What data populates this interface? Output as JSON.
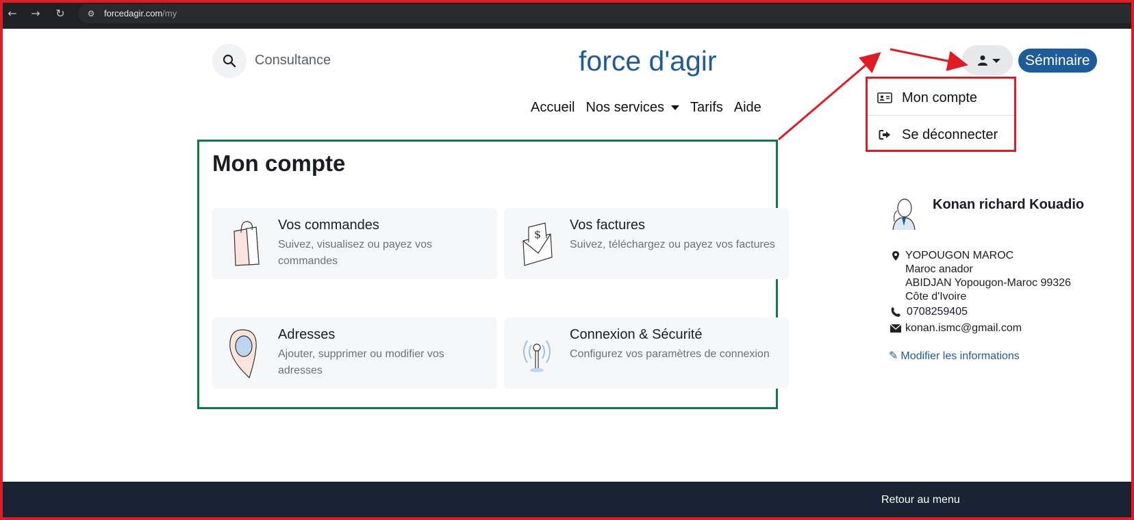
{
  "browser": {
    "url_host": "forcedagir.com",
    "url_path": "/my",
    "back_icon": "arrow-left-icon",
    "forward_icon": "arrow-right-icon",
    "reload_icon": "reload-icon"
  },
  "header": {
    "search_placeholder": "Consultance",
    "brand": "force d'agir",
    "seminaire": "Séminaire"
  },
  "nav": {
    "items": [
      "Accueil",
      "Nos services",
      "Tarifs",
      "Aide"
    ]
  },
  "dropdown": {
    "items": [
      "Mon compte",
      "Se déconnecter"
    ]
  },
  "main": {
    "title": "Mon compte",
    "cards": [
      {
        "title": "Vos commandes",
        "desc": "Suivez, visualisez ou payez vos commandes"
      },
      {
        "title": "Vos factures",
        "desc": "Suivez, téléchargez ou payez vos factures"
      },
      {
        "title": "Adresses",
        "desc": "Ajouter, supprimer ou modifier vos adresses"
      },
      {
        "title": "Connexion & Sécurité",
        "desc": "Configurez vos paramètres de connexion"
      }
    ]
  },
  "profile": {
    "name": "Konan richard Kouadio",
    "address_lines": [
      "YOPOUGON MAROC",
      "Maroc anador",
      "ABIDJAN Yopougon-Maroc 99326",
      "Côte d'Ivoire"
    ],
    "phone": "0708259405",
    "email": "konan.ismc@gmail.com",
    "edit_link": "Modifier les informations"
  },
  "footer": {
    "back": "Retour au menu"
  },
  "colors": {
    "brand": "#1e5b9a",
    "annotation_red": "#e01b24",
    "annotation_green": "#0a7a4a",
    "footer_bg": "#1a2332"
  }
}
